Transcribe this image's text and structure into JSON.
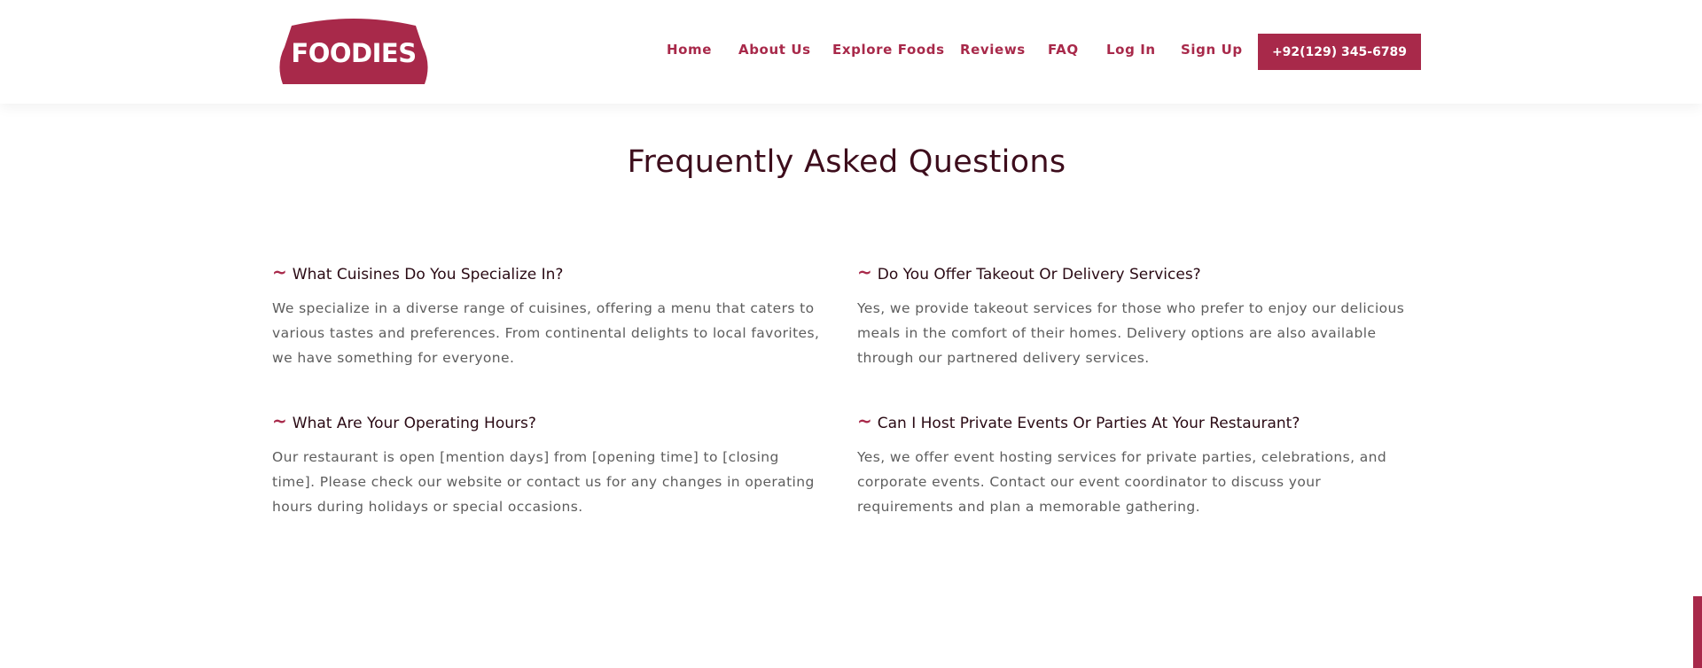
{
  "brand": {
    "logo_text": "FOODIES",
    "accent_color": "#a8294a",
    "dark_text_color": "#3d0d1c"
  },
  "nav": {
    "items": [
      {
        "label": "Home"
      },
      {
        "label": "About Us"
      },
      {
        "label": "Explore Foods"
      },
      {
        "label": "Reviews"
      },
      {
        "label": "FAQ"
      },
      {
        "label": "Log In"
      },
      {
        "label": "Sign Up"
      }
    ],
    "phone_button": "+92(129) 345-6789"
  },
  "page": {
    "title": "Frequently Asked Questions"
  },
  "faqs": [
    {
      "marker": "~",
      "question": "What Cuisines Do You Specialize In?",
      "answer": "We specialize in a diverse range of cuisines, offering a menu that caters to various tastes and preferences. From continental delights to local favorites, we have something for everyone."
    },
    {
      "marker": "~",
      "question": "Do You Offer Takeout Or Delivery Services?",
      "answer": "Yes, we provide takeout services for those who prefer to enjoy our delicious meals in the comfort of their homes. Delivery options are also available through our partnered delivery services."
    },
    {
      "marker": "~",
      "question": "What Are Your Operating Hours?",
      "answer": "Our restaurant is open [mention days] from [opening time] to [closing time]. Please check our website or contact us for any changes in operating hours during holidays or special occasions."
    },
    {
      "marker": "~",
      "question": "Can I Host Private Events Or Parties At Your Restaurant?",
      "answer": "Yes, we offer event hosting services for private parties, celebrations, and corporate events. Contact our event coordinator to discuss your requirements and plan a memorable gathering."
    }
  ]
}
